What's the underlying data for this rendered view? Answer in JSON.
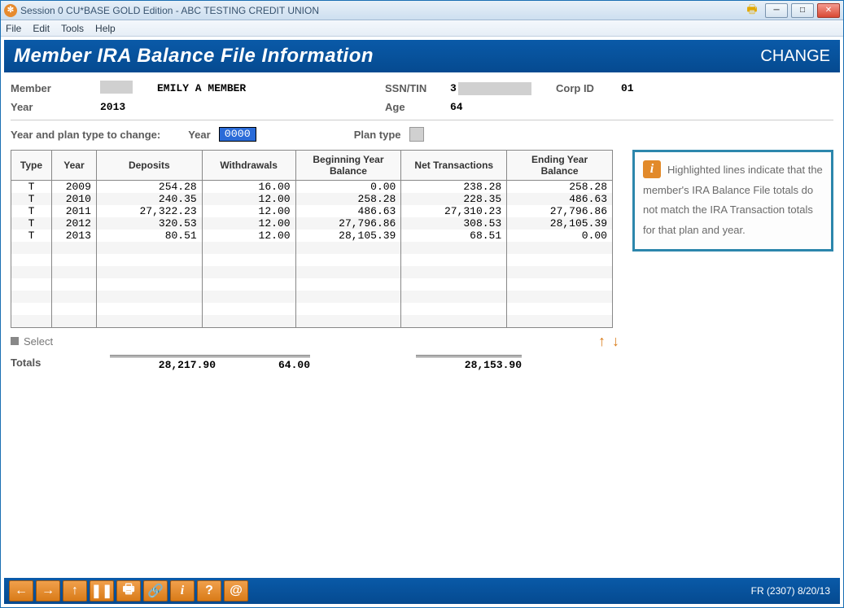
{
  "window_title": "Session 0 CU*BASE GOLD Edition - ABC TESTING CREDIT UNION",
  "menu": {
    "file": "File",
    "edit": "Edit",
    "tools": "Tools",
    "help": "Help"
  },
  "header": {
    "title": "Member IRA Balance File Information",
    "mode": "CHANGE"
  },
  "member": {
    "label": "Member",
    "name": "EMILY A MEMBER",
    "ssn_label": "SSN/TIN",
    "ssn_prefix": "3",
    "corp_label": "Corp ID",
    "corp_id": "01",
    "year_label": "Year",
    "year": "2013",
    "age_label": "Age",
    "age": "64"
  },
  "change": {
    "label": "Year and plan type to change:",
    "year_label": "Year",
    "year_value": "0000",
    "plan_label": "Plan type"
  },
  "table": {
    "headers": {
      "type": "Type",
      "year": "Year",
      "deposits": "Deposits",
      "withdrawals": "Withdrawals",
      "begin": "Beginning Year Balance",
      "net": "Net Transactions",
      "end": "Ending Year Balance"
    },
    "rows": [
      {
        "type": "T",
        "year": "2009",
        "deposits": "254.28",
        "withdrawals": "16.00",
        "begin": "0.00",
        "net": "238.28",
        "end": "258.28"
      },
      {
        "type": "T",
        "year": "2010",
        "deposits": "240.35",
        "withdrawals": "12.00",
        "begin": "258.28",
        "net": "228.35",
        "end": "486.63"
      },
      {
        "type": "T",
        "year": "2011",
        "deposits": "27,322.23",
        "withdrawals": "12.00",
        "begin": "486.63",
        "net": "27,310.23",
        "end": "27,796.86"
      },
      {
        "type": "T",
        "year": "2012",
        "deposits": "320.53",
        "withdrawals": "12.00",
        "begin": "27,796.86",
        "net": "308.53",
        "end": "28,105.39"
      },
      {
        "type": "T",
        "year": "2013",
        "deposits": "80.51",
        "withdrawals": "12.00",
        "begin": "28,105.39",
        "net": "68.51",
        "end": "0.00"
      }
    ]
  },
  "select_label": "Select",
  "totals": {
    "label": "Totals",
    "deposits": "28,217.90",
    "withdrawals": "64.00",
    "net": "28,153.90"
  },
  "info_text": "Highlighted lines indicate that the member's IRA Balance File totals do not match the IRA Transaction totals for that plan and year.",
  "footer_text": "FR (2307) 8/20/13"
}
